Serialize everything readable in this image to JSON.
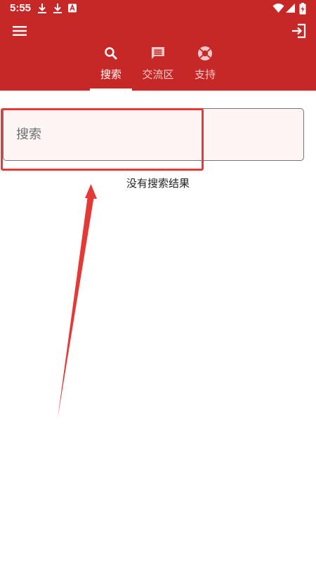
{
  "status_bar": {
    "time": "5:55",
    "icons": [
      "download-icon",
      "download-icon",
      "notification-a-icon",
      "wifi-icon",
      "signal-icon",
      "battery-charging-icon"
    ]
  },
  "app_bar": {
    "menu_icon": "menu-icon",
    "login_icon": "login-icon",
    "color": "#c62828"
  },
  "tabs": [
    {
      "label": "搜索",
      "icon": "search-icon",
      "selected": true
    },
    {
      "label": "交流区",
      "icon": "chat-icon",
      "selected": false
    },
    {
      "label": "支持",
      "icon": "lifebuoy-icon",
      "selected": false
    }
  ],
  "search": {
    "placeholder": "搜索",
    "value": ""
  },
  "results": {
    "empty_message": "没有搜索结果"
  },
  "annotation": {
    "color": "#e53935"
  }
}
